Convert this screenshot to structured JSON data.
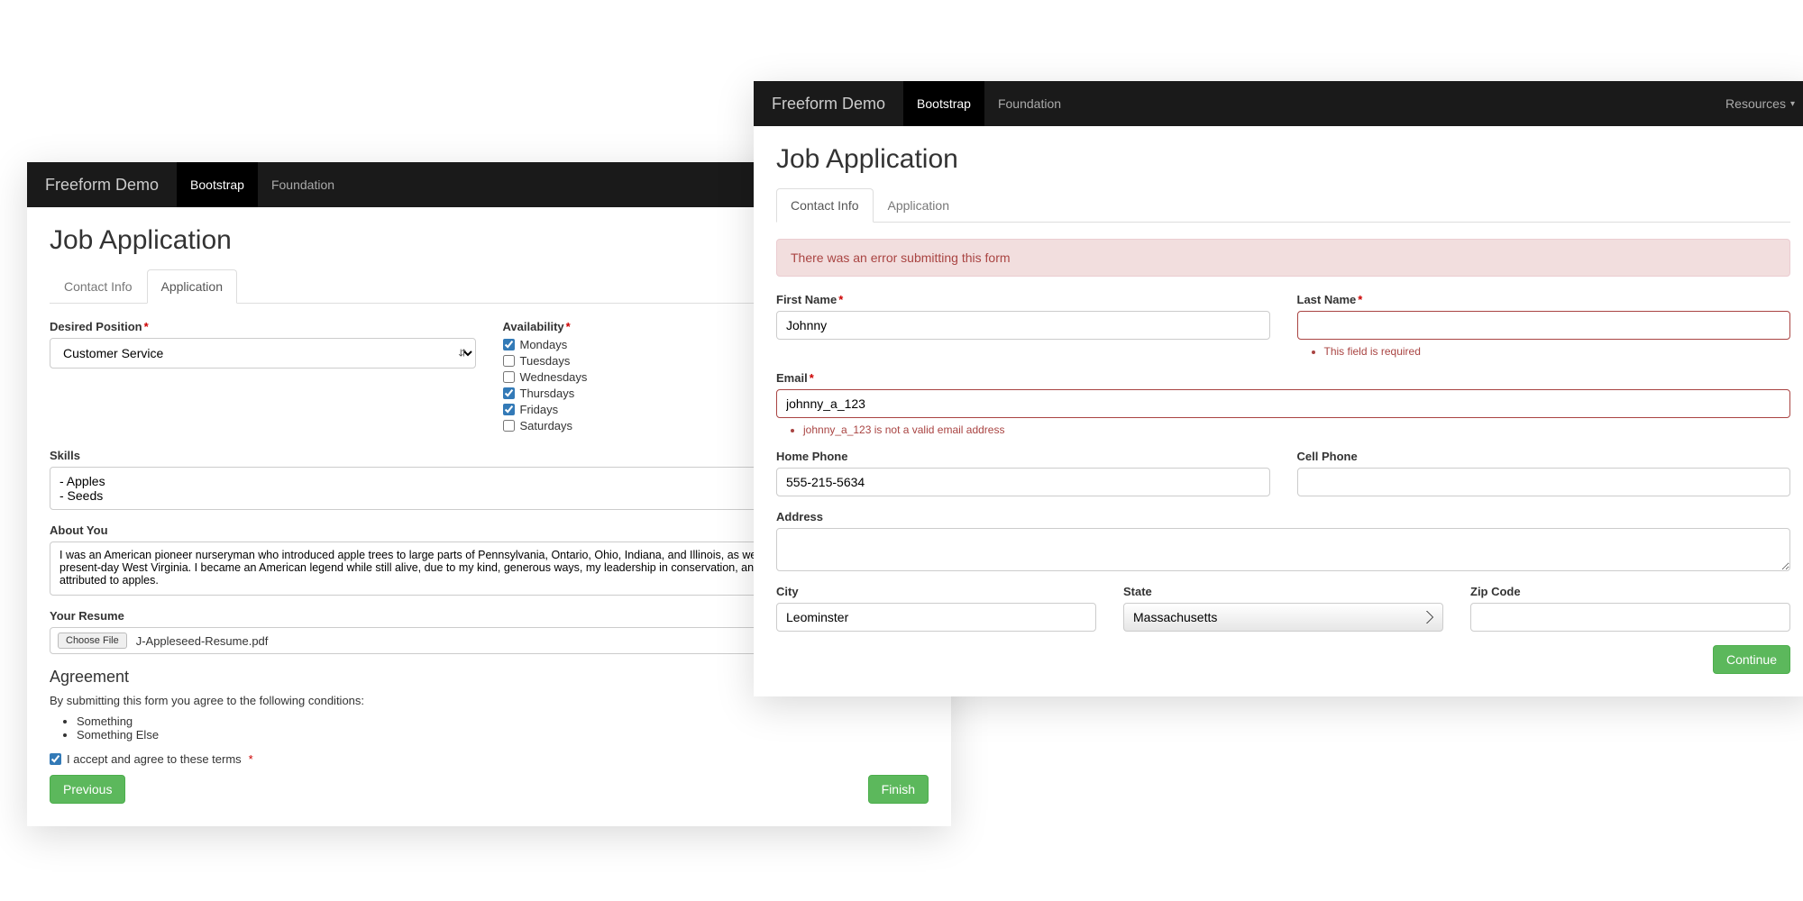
{
  "nav": {
    "brand": "Freeform Demo",
    "items": [
      "Bootstrap",
      "Foundation"
    ],
    "resources": "Resources"
  },
  "page_title": "Job Application",
  "tabs": {
    "contact": "Contact Info",
    "application": "Application"
  },
  "right": {
    "error_banner": "There was an error submitting this form",
    "first_name": {
      "label": "First Name",
      "value": "Johnny"
    },
    "last_name": {
      "label": "Last Name",
      "value": "",
      "error": "This field is required"
    },
    "email": {
      "label": "Email",
      "value": "johnny_a_123",
      "error": "johnny_a_123 is not a valid email address"
    },
    "home_phone": {
      "label": "Home Phone",
      "value": "555-215-5634"
    },
    "cell_phone": {
      "label": "Cell Phone",
      "value": ""
    },
    "address": {
      "label": "Address",
      "value": ""
    },
    "city": {
      "label": "City",
      "value": "Leominster"
    },
    "state": {
      "label": "State",
      "value": "Massachusetts"
    },
    "zip": {
      "label": "Zip Code",
      "value": ""
    },
    "continue": "Continue"
  },
  "left": {
    "desired_position": {
      "label": "Desired Position",
      "value": "Customer Service"
    },
    "availability": {
      "label": "Availability",
      "days": [
        {
          "label": "Mondays",
          "checked": true
        },
        {
          "label": "Tuesdays",
          "checked": false
        },
        {
          "label": "Wednesdays",
          "checked": false
        },
        {
          "label": "Thursdays",
          "checked": true
        },
        {
          "label": "Fridays",
          "checked": true
        },
        {
          "label": "Saturdays",
          "checked": false
        }
      ]
    },
    "skills": {
      "label": "Skills",
      "value": "- Apples\n- Seeds"
    },
    "about": {
      "label": "About You",
      "value": "I was an American pioneer nurseryman who introduced apple trees to large parts of Pennsylvania, Ontario, Ohio, Indiana, and Illinois, as well as the northern counties of present-day West Virginia. I became an American legend while still alive, due to my kind, generous ways, my leadership in conservation, and the symbolic importance I attributed to apples."
    },
    "resume": {
      "label": "Your Resume",
      "button": "Choose File",
      "filename": "J-Appleseed-Resume.pdf"
    },
    "agreement": {
      "heading": "Agreement",
      "intro": "By submitting this form you agree to the following conditions:",
      "items": [
        "Something",
        "Something Else"
      ],
      "accept_label": "I accept and agree to these terms"
    },
    "previous": "Previous",
    "finish": "Finish"
  }
}
